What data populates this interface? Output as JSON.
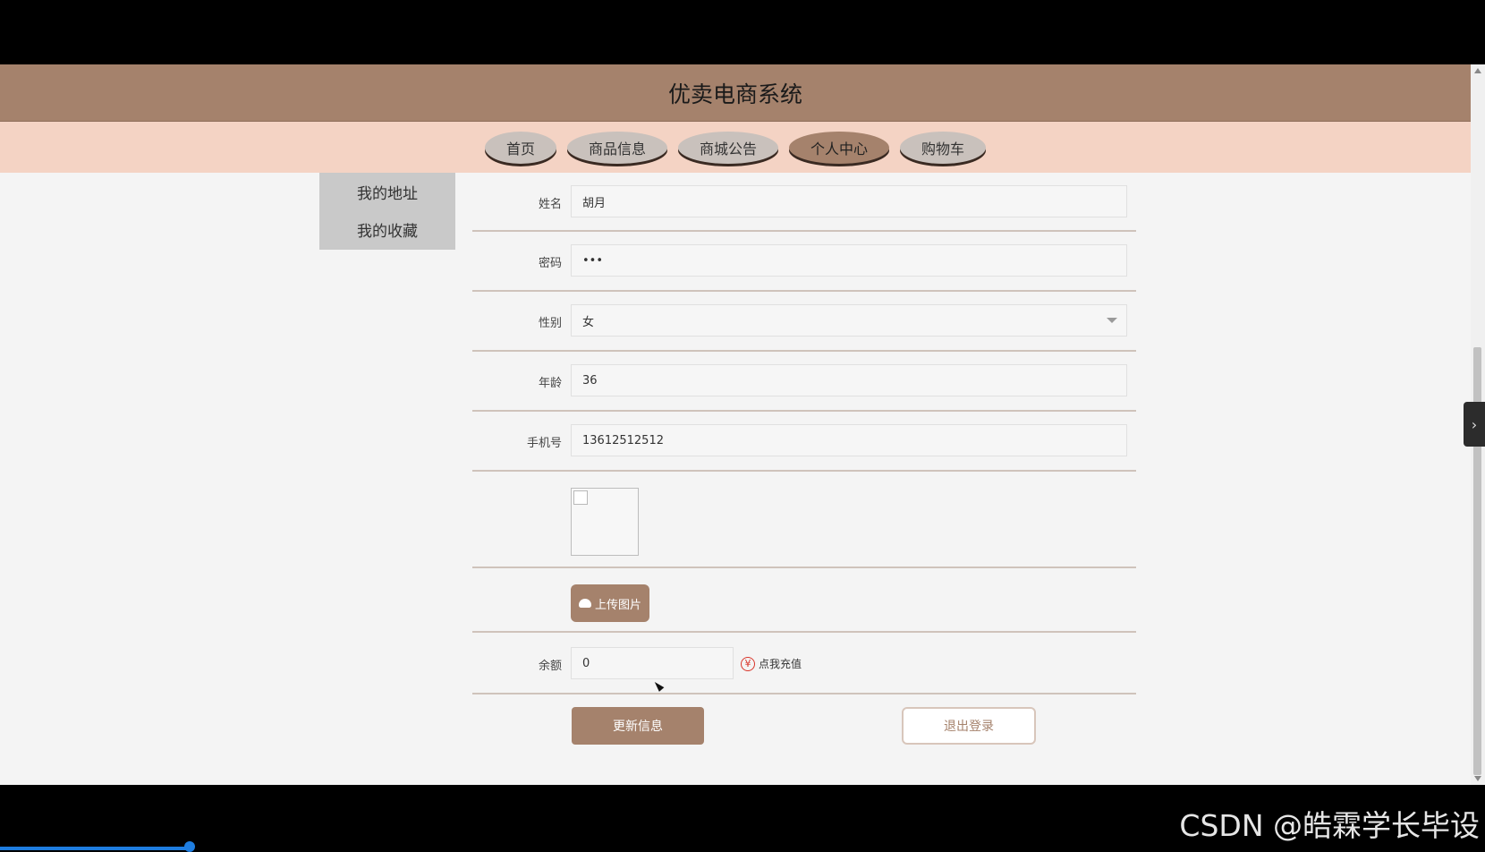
{
  "site": {
    "title": "优卖电商系统"
  },
  "nav": {
    "items": [
      {
        "label": "首页",
        "active": false
      },
      {
        "label": "商品信息",
        "active": false
      },
      {
        "label": "商城公告",
        "active": false
      },
      {
        "label": "个人中心",
        "active": true
      },
      {
        "label": "购物车",
        "active": false
      }
    ]
  },
  "sidebar": {
    "items": [
      {
        "label": "我的地址"
      },
      {
        "label": "我的收藏"
      }
    ]
  },
  "form": {
    "name": {
      "label": "姓名",
      "value": "胡月"
    },
    "password": {
      "label": "密码",
      "value": "•••"
    },
    "gender": {
      "label": "性别",
      "value": "女"
    },
    "age": {
      "label": "年龄",
      "value": "36"
    },
    "phone": {
      "label": "手机号",
      "value": "13612512512"
    },
    "upload_button": "上传图片",
    "balance": {
      "label": "余额",
      "value": "0"
    },
    "recharge": {
      "icon": "yen-icon",
      "label": "点我充值"
    },
    "update_button": "更新信息",
    "logout_button": "退出登录"
  },
  "watermark": "CSDN @皓霖学长毕设",
  "colors": {
    "brand": "#a5826c",
    "nav_bg": "#f4d3c4",
    "recharge_icon": "#d9362b"
  }
}
